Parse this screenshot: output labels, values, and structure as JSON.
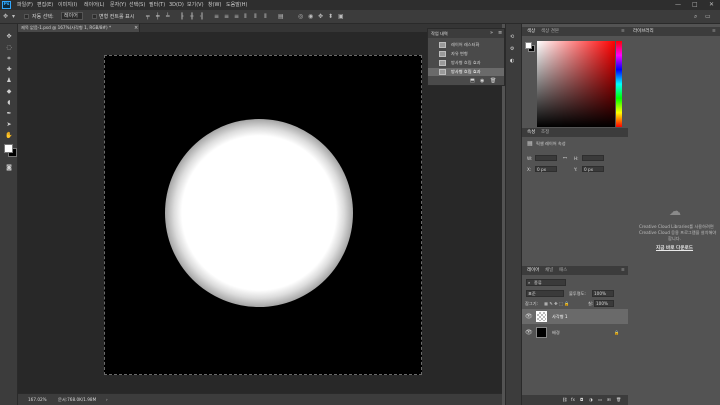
{
  "app": {
    "logo": "Ps"
  },
  "menu": [
    "파일(F)",
    "편집(E)",
    "이미지(I)",
    "레이어(L)",
    "문자(Y)",
    "선택(S)",
    "필터(T)",
    "3D(D)",
    "보기(V)",
    "창(W)",
    "도움말(H)"
  ],
  "window_controls": {
    "minimize": "—",
    "maximize": "□",
    "close": "✕"
  },
  "options": {
    "auto_select_label": "자동 선택:",
    "auto_select_value": "레이어",
    "transform_label": "변형 컨트롤 표시"
  },
  "document": {
    "tab_title": "제목 없음-1.psd @ 167%(사각형 1, RGB/8#) *",
    "tab_close": "×",
    "zoom": "167.02%",
    "doc_size": "문서:768.0K/1.98M"
  },
  "history": {
    "tab": "작업 내역",
    "items": [
      "레이어 래스터화",
      "자유 변형",
      "방사형 흐림 효과",
      "방사형 흐림 효과"
    ],
    "selected_index": 3
  },
  "color_panel": {
    "tabs": [
      "색상",
      "색상 견본"
    ]
  },
  "properties_panel": {
    "tabs": [
      "속성",
      "조정"
    ],
    "title": "픽셀 레이어 속성",
    "w_label": "W:",
    "h_label": "H:",
    "x_label": "X:",
    "x_value": "0 px",
    "y_label": "Y:",
    "y_value": "0 px"
  },
  "layers_panel": {
    "tabs": [
      "레이어",
      "채널",
      "패스"
    ],
    "filter_label": "종류",
    "blend_mode": "표준",
    "opacity_label": "불투명도:",
    "opacity_value": "100%",
    "lock_label": "잠그기:",
    "fill_label": "칠:",
    "fill_value": "100%",
    "layers": [
      {
        "name": "사각형 1",
        "selected": true,
        "locked": false
      },
      {
        "name": "배경",
        "selected": false,
        "locked": true
      }
    ]
  },
  "library_panel": {
    "tab": "라이브러리",
    "message_line1": "Creative Cloud Libraries를 사용하려면",
    "message_line2": "Creative Cloud 응용 프로그램을 설치해야",
    "message_line3": "합니다.",
    "install_link": "지금 바로 다운로드"
  },
  "colors": {
    "accent": "#31a8ff",
    "selected_row": "#6a6a6a"
  }
}
